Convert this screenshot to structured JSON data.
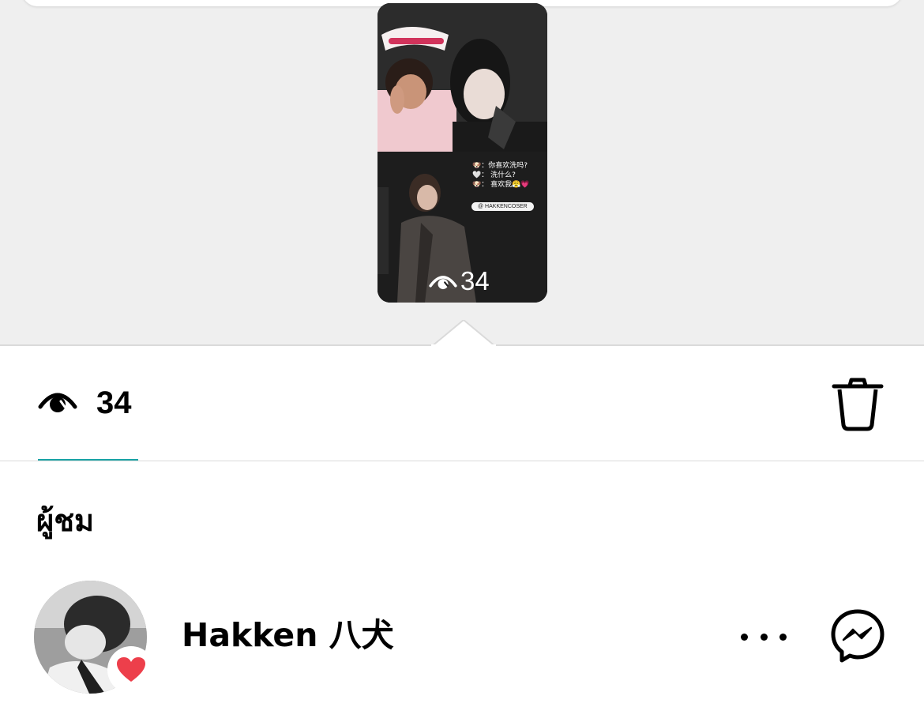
{
  "story": {
    "caption_lines": [
      "🐶：你喜欢洗吗?",
      "🤍： 洗什么?",
      "🐶： 喜欢我😤💗"
    ],
    "mention": "@ HAKKENCOSER",
    "views": "34"
  },
  "stats": {
    "views": "34"
  },
  "viewers": {
    "title": "ผู้ชม",
    "items": [
      {
        "name": "Hakken 八犬",
        "reaction": "heart-icon"
      }
    ]
  },
  "icons": {
    "views": "eye-icon",
    "delete": "trash-icon",
    "more": "more-icon",
    "message": "messenger-icon"
  },
  "colors": {
    "accent": "#1aa3a6",
    "heart": "#ed3f4b",
    "background": "#efefef"
  }
}
